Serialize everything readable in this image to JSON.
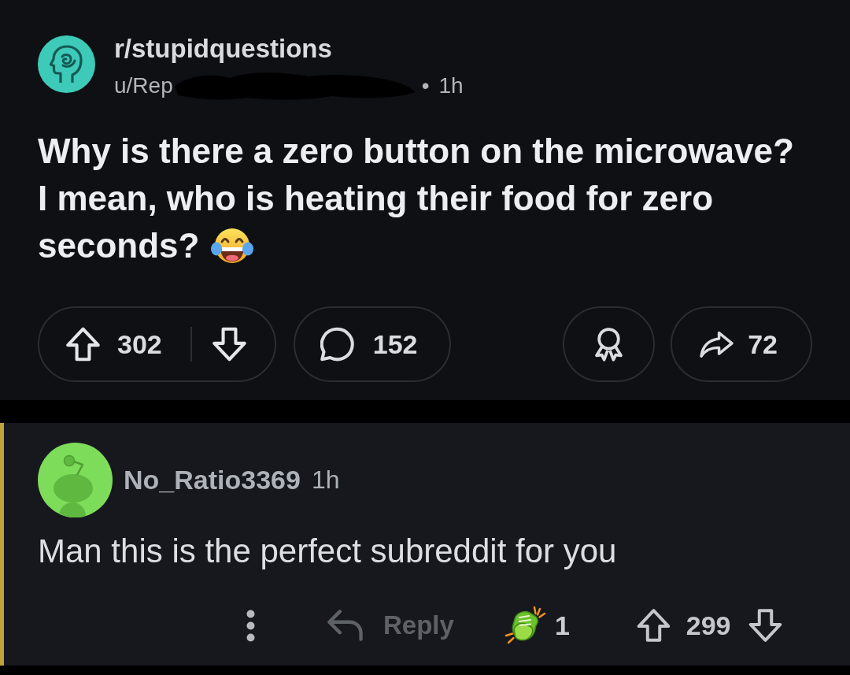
{
  "post": {
    "subreddit": "r/stupidquestions",
    "author": "u/Rep",
    "author_redacted": true,
    "separator": "•",
    "age": "1h",
    "title_lines": [
      "Why is there a zero button on the microwave?",
      "I mean, who is heating their food for zero",
      "seconds?"
    ],
    "actions": [
      {
        "kind": "vote",
        "upvotes": "302"
      },
      {
        "kind": "comments",
        "count": "152"
      },
      {
        "kind": "award"
      },
      {
        "kind": "share",
        "count": "72"
      }
    ]
  },
  "comment": {
    "author": "No_Ratio3369",
    "age": "1h",
    "body": "Man this is the perfect subreddit for you",
    "reply_label": "Reply",
    "award_count": "1",
    "score": "299"
  }
}
